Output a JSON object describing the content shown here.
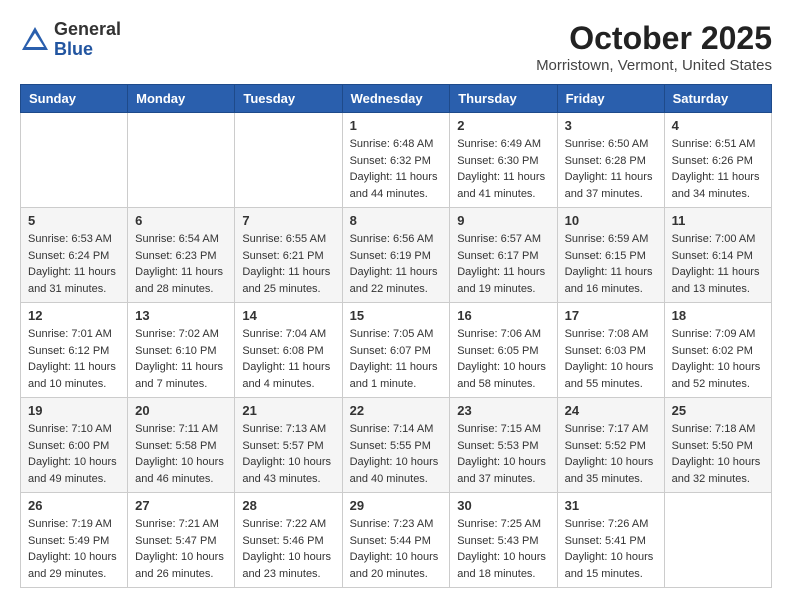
{
  "header": {
    "logo_general": "General",
    "logo_blue": "Blue",
    "month_title": "October 2025",
    "location": "Morristown, Vermont, United States"
  },
  "days_of_week": [
    "Sunday",
    "Monday",
    "Tuesday",
    "Wednesday",
    "Thursday",
    "Friday",
    "Saturday"
  ],
  "weeks": [
    [
      {
        "day": "",
        "sunrise": "",
        "sunset": "",
        "daylight": ""
      },
      {
        "day": "",
        "sunrise": "",
        "sunset": "",
        "daylight": ""
      },
      {
        "day": "",
        "sunrise": "",
        "sunset": "",
        "daylight": ""
      },
      {
        "day": "1",
        "sunrise": "Sunrise: 6:48 AM",
        "sunset": "Sunset: 6:32 PM",
        "daylight": "Daylight: 11 hours and 44 minutes."
      },
      {
        "day": "2",
        "sunrise": "Sunrise: 6:49 AM",
        "sunset": "Sunset: 6:30 PM",
        "daylight": "Daylight: 11 hours and 41 minutes."
      },
      {
        "day": "3",
        "sunrise": "Sunrise: 6:50 AM",
        "sunset": "Sunset: 6:28 PM",
        "daylight": "Daylight: 11 hours and 37 minutes."
      },
      {
        "day": "4",
        "sunrise": "Sunrise: 6:51 AM",
        "sunset": "Sunset: 6:26 PM",
        "daylight": "Daylight: 11 hours and 34 minutes."
      }
    ],
    [
      {
        "day": "5",
        "sunrise": "Sunrise: 6:53 AM",
        "sunset": "Sunset: 6:24 PM",
        "daylight": "Daylight: 11 hours and 31 minutes."
      },
      {
        "day": "6",
        "sunrise": "Sunrise: 6:54 AM",
        "sunset": "Sunset: 6:23 PM",
        "daylight": "Daylight: 11 hours and 28 minutes."
      },
      {
        "day": "7",
        "sunrise": "Sunrise: 6:55 AM",
        "sunset": "Sunset: 6:21 PM",
        "daylight": "Daylight: 11 hours and 25 minutes."
      },
      {
        "day": "8",
        "sunrise": "Sunrise: 6:56 AM",
        "sunset": "Sunset: 6:19 PM",
        "daylight": "Daylight: 11 hours and 22 minutes."
      },
      {
        "day": "9",
        "sunrise": "Sunrise: 6:57 AM",
        "sunset": "Sunset: 6:17 PM",
        "daylight": "Daylight: 11 hours and 19 minutes."
      },
      {
        "day": "10",
        "sunrise": "Sunrise: 6:59 AM",
        "sunset": "Sunset: 6:15 PM",
        "daylight": "Daylight: 11 hours and 16 minutes."
      },
      {
        "day": "11",
        "sunrise": "Sunrise: 7:00 AM",
        "sunset": "Sunset: 6:14 PM",
        "daylight": "Daylight: 11 hours and 13 minutes."
      }
    ],
    [
      {
        "day": "12",
        "sunrise": "Sunrise: 7:01 AM",
        "sunset": "Sunset: 6:12 PM",
        "daylight": "Daylight: 11 hours and 10 minutes."
      },
      {
        "day": "13",
        "sunrise": "Sunrise: 7:02 AM",
        "sunset": "Sunset: 6:10 PM",
        "daylight": "Daylight: 11 hours and 7 minutes."
      },
      {
        "day": "14",
        "sunrise": "Sunrise: 7:04 AM",
        "sunset": "Sunset: 6:08 PM",
        "daylight": "Daylight: 11 hours and 4 minutes."
      },
      {
        "day": "15",
        "sunrise": "Sunrise: 7:05 AM",
        "sunset": "Sunset: 6:07 PM",
        "daylight": "Daylight: 11 hours and 1 minute."
      },
      {
        "day": "16",
        "sunrise": "Sunrise: 7:06 AM",
        "sunset": "Sunset: 6:05 PM",
        "daylight": "Daylight: 10 hours and 58 minutes."
      },
      {
        "day": "17",
        "sunrise": "Sunrise: 7:08 AM",
        "sunset": "Sunset: 6:03 PM",
        "daylight": "Daylight: 10 hours and 55 minutes."
      },
      {
        "day": "18",
        "sunrise": "Sunrise: 7:09 AM",
        "sunset": "Sunset: 6:02 PM",
        "daylight": "Daylight: 10 hours and 52 minutes."
      }
    ],
    [
      {
        "day": "19",
        "sunrise": "Sunrise: 7:10 AM",
        "sunset": "Sunset: 6:00 PM",
        "daylight": "Daylight: 10 hours and 49 minutes."
      },
      {
        "day": "20",
        "sunrise": "Sunrise: 7:11 AM",
        "sunset": "Sunset: 5:58 PM",
        "daylight": "Daylight: 10 hours and 46 minutes."
      },
      {
        "day": "21",
        "sunrise": "Sunrise: 7:13 AM",
        "sunset": "Sunset: 5:57 PM",
        "daylight": "Daylight: 10 hours and 43 minutes."
      },
      {
        "day": "22",
        "sunrise": "Sunrise: 7:14 AM",
        "sunset": "Sunset: 5:55 PM",
        "daylight": "Daylight: 10 hours and 40 minutes."
      },
      {
        "day": "23",
        "sunrise": "Sunrise: 7:15 AM",
        "sunset": "Sunset: 5:53 PM",
        "daylight": "Daylight: 10 hours and 37 minutes."
      },
      {
        "day": "24",
        "sunrise": "Sunrise: 7:17 AM",
        "sunset": "Sunset: 5:52 PM",
        "daylight": "Daylight: 10 hours and 35 minutes."
      },
      {
        "day": "25",
        "sunrise": "Sunrise: 7:18 AM",
        "sunset": "Sunset: 5:50 PM",
        "daylight": "Daylight: 10 hours and 32 minutes."
      }
    ],
    [
      {
        "day": "26",
        "sunrise": "Sunrise: 7:19 AM",
        "sunset": "Sunset: 5:49 PM",
        "daylight": "Daylight: 10 hours and 29 minutes."
      },
      {
        "day": "27",
        "sunrise": "Sunrise: 7:21 AM",
        "sunset": "Sunset: 5:47 PM",
        "daylight": "Daylight: 10 hours and 26 minutes."
      },
      {
        "day": "28",
        "sunrise": "Sunrise: 7:22 AM",
        "sunset": "Sunset: 5:46 PM",
        "daylight": "Daylight: 10 hours and 23 minutes."
      },
      {
        "day": "29",
        "sunrise": "Sunrise: 7:23 AM",
        "sunset": "Sunset: 5:44 PM",
        "daylight": "Daylight: 10 hours and 20 minutes."
      },
      {
        "day": "30",
        "sunrise": "Sunrise: 7:25 AM",
        "sunset": "Sunset: 5:43 PM",
        "daylight": "Daylight: 10 hours and 18 minutes."
      },
      {
        "day": "31",
        "sunrise": "Sunrise: 7:26 AM",
        "sunset": "Sunset: 5:41 PM",
        "daylight": "Daylight: 10 hours and 15 minutes."
      },
      {
        "day": "",
        "sunrise": "",
        "sunset": "",
        "daylight": ""
      }
    ]
  ]
}
